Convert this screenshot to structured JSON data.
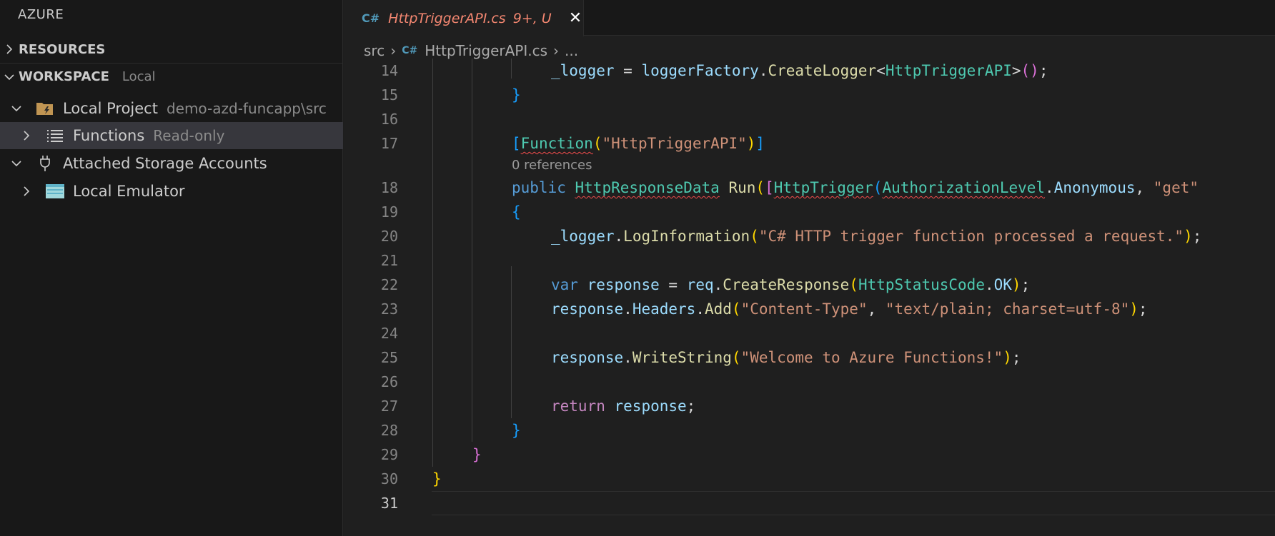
{
  "sidebar": {
    "title": "AZURE",
    "resources_label": "RESOURCES",
    "workspace_label": "WORKSPACE",
    "workspace_desc": "Local",
    "items": [
      {
        "label": "Local Project",
        "desc": "demo-azd-funcapp\\src"
      },
      {
        "label": "Functions",
        "desc": "Read-only"
      },
      {
        "label": "Attached Storage Accounts",
        "desc": ""
      },
      {
        "label": "Local Emulator",
        "desc": ""
      }
    ]
  },
  "tab": {
    "icon": "C#",
    "name": "HttpTriggerAPI.cs",
    "status": "9+, U"
  },
  "breadcrumb": {
    "folder": "src",
    "file": "HttpTriggerAPI.cs",
    "more": "..."
  },
  "editor": {
    "codelens": "0 references",
    "line_numbers": [
      "14",
      "15",
      "16",
      "17",
      "18",
      "19",
      "20",
      "21",
      "22",
      "23",
      "24",
      "25",
      "26",
      "27",
      "28",
      "29",
      "30",
      "31"
    ],
    "tokens": {
      "logger": "_logger",
      "assign": " = ",
      "loggerFactory": "loggerFactory",
      "createLogger": "CreateLogger",
      "httpTriggerApiType": "HttpTriggerAPI",
      "function_attr": "Function",
      "function_name_str": "\"HttpTriggerAPI\"",
      "public": "public",
      "httpResponseData": "HttpResponseData",
      "run": "Run",
      "httpTrigger": "HttpTrigger",
      "authorizationLevel": "AuthorizationLevel",
      "anonymous": "Anonymous",
      "get_str": "\"get\"",
      "logInformation": "LogInformation",
      "log_str": "\"C# HTTP trigger function processed a request.\"",
      "var": "var",
      "response": "response",
      "req": "req",
      "createResponse": "CreateResponse",
      "httpStatusCode": "HttpStatusCode",
      "ok": "OK",
      "headers": "Headers",
      "add": "Add",
      "content_type_str": "\"Content-Type\"",
      "text_plain_str": "\"text/plain; charset=utf-8\"",
      "writeString": "WriteString",
      "welcome_str": "\"Welcome to Azure Functions!\"",
      "return": "return"
    }
  },
  "colors": {
    "keyword": "#569cd6",
    "control": "#c586c0",
    "type": "#4ec9b0",
    "function": "#dcdcaa",
    "string": "#ce9178",
    "variable": "#9cdcfe",
    "error_tab": "#f48771"
  }
}
